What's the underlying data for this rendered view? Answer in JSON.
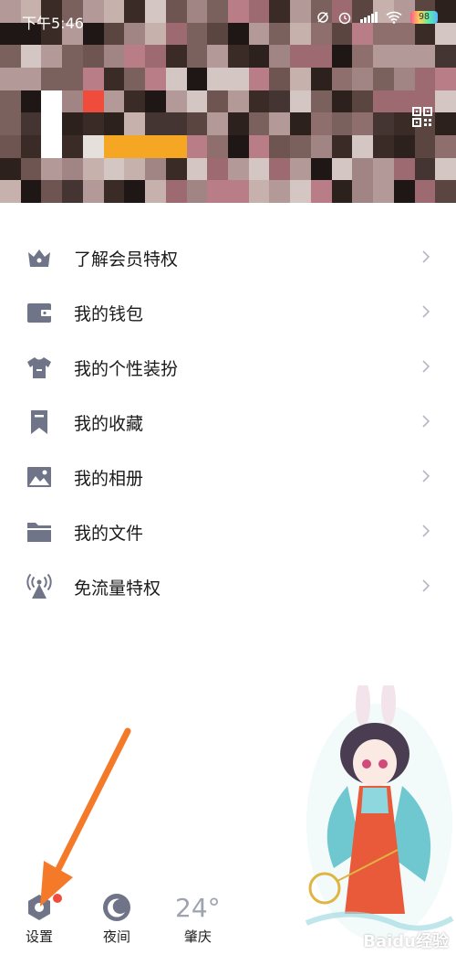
{
  "status_bar": {
    "time": "下午5:46",
    "battery": "98"
  },
  "header": {
    "qr_icon": "qr-code-icon"
  },
  "menu": {
    "items": [
      {
        "label": "了解会员特权",
        "icon": "crown-icon"
      },
      {
        "label": "我的钱包",
        "icon": "wallet-icon"
      },
      {
        "label": "我的个性装扮",
        "icon": "shirt-icon"
      },
      {
        "label": "我的收藏",
        "icon": "bookmark-icon"
      },
      {
        "label": "我的相册",
        "icon": "photo-icon"
      },
      {
        "label": "我的文件",
        "icon": "folder-icon"
      },
      {
        "label": "免流量特权",
        "icon": "signal-tower-icon"
      }
    ]
  },
  "bottom_bar": {
    "settings_label": "设置",
    "night_label": "夜间",
    "weather_temp": "24°",
    "weather_city": "肇庆"
  },
  "watermark": "Baidu经验",
  "colors": {
    "icon_gray": "#6f7488",
    "accent_arrow": "#f47a2a",
    "red_dot": "#f04c3c"
  }
}
